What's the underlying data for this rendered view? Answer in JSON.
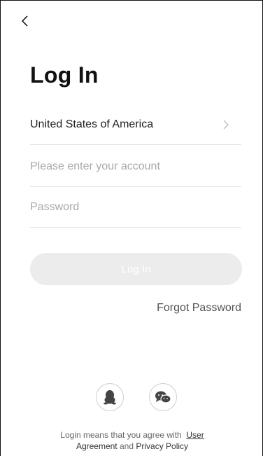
{
  "header": {
    "back_icon": "chevron-left-icon"
  },
  "page": {
    "title": "Log In"
  },
  "form": {
    "country": "United States of America",
    "country_chevron_icon": "chevron-right-icon",
    "account_placeholder": "Please enter your account",
    "account_value": "",
    "password_placeholder": "Password",
    "password_value": "",
    "login_label": "Log In",
    "forgot_label": "Forgot Password"
  },
  "social": {
    "qq_icon": "qq-penguin-icon",
    "wechat_icon": "wechat-icon"
  },
  "legal": {
    "prefix": "Login means that you agree with",
    "user": "User",
    "agreement": "Agreement",
    "and": "and",
    "privacy": "Privacy Policy"
  },
  "colors": {
    "button_disabled": "#ececec",
    "divider": "#e2e2e2",
    "placeholder": "#a9a9a9"
  }
}
